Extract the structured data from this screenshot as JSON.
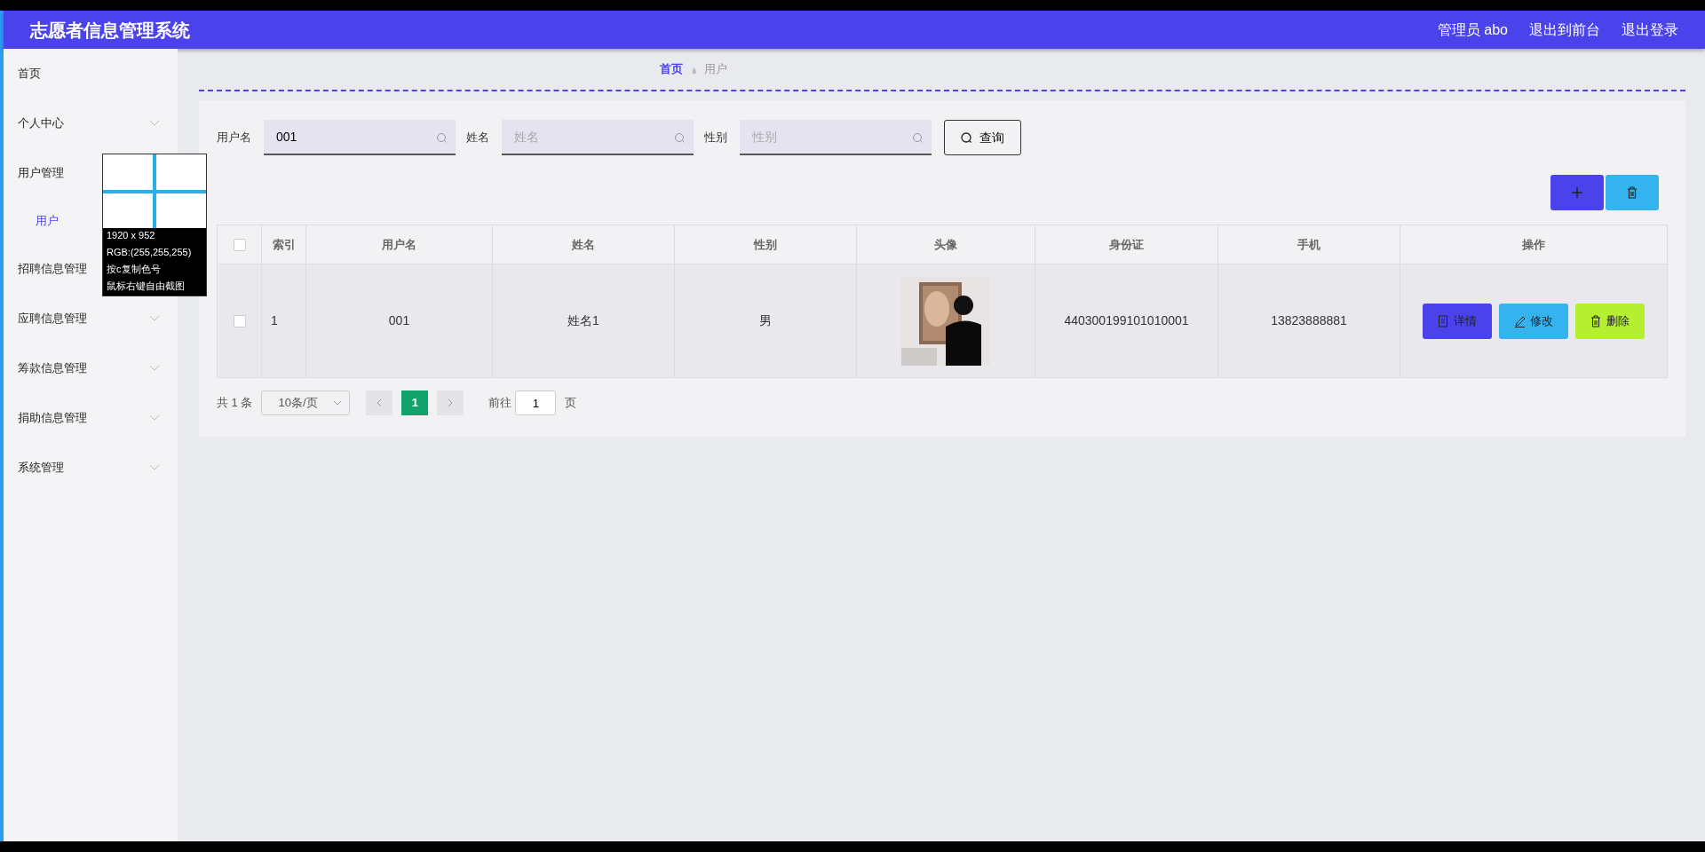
{
  "header": {
    "title": "志愿者信息管理系统",
    "links": [
      "管理员 abo",
      "退出到前台",
      "退出登录"
    ]
  },
  "sidebar": {
    "items": [
      {
        "label": "首页",
        "kind": "link"
      },
      {
        "label": "个人中心",
        "kind": "menu",
        "expanded": false
      },
      {
        "label": "用户管理",
        "kind": "menu",
        "expanded": true,
        "children": [
          {
            "label": "用户",
            "selected": true
          }
        ]
      },
      {
        "label": "招聘信息管理",
        "kind": "menu",
        "expanded": false
      },
      {
        "label": "应聘信息管理",
        "kind": "menu",
        "expanded": false
      },
      {
        "label": "筹款信息管理",
        "kind": "menu",
        "expanded": false
      },
      {
        "label": "捐助信息管理",
        "kind": "menu",
        "expanded": false
      },
      {
        "label": "系统管理",
        "kind": "menu",
        "expanded": false
      }
    ]
  },
  "breadcrumb": [
    {
      "label": "首页",
      "selected": true
    },
    {
      "label": "用户",
      "selected": false
    }
  ],
  "search": {
    "fields": [
      {
        "label": "用户名",
        "value": "001"
      },
      {
        "label": "姓名",
        "placeholder": "姓名"
      },
      {
        "label": "性别",
        "placeholder": "性别"
      }
    ],
    "button": "查询"
  },
  "table": {
    "header_checked": false,
    "columns": [
      "索引",
      "用户名",
      "姓名",
      "性别",
      "头像",
      "身份证",
      "手机",
      "操作"
    ],
    "rows": [
      {
        "checked": false,
        "index": "1",
        "username": "001",
        "name": "姓名1",
        "gender": "男",
        "avatar": {
          "kind": "picture"
        },
        "id_card": "440300199101010001",
        "phone": "13823888881",
        "actions": [
          {
            "kind": "detail",
            "label": "详情"
          },
          {
            "kind": "edit",
            "label": "修改"
          },
          {
            "kind": "delete",
            "label": "删除"
          }
        ]
      }
    ]
  },
  "pagination": {
    "total": "共 1 条",
    "page_size": "10条/页",
    "pages": [
      {
        "label": "1",
        "selected": true
      }
    ],
    "goto_label": "前往",
    "goto_value": "1",
    "goto_suffix": "页"
  },
  "overlay": {
    "lines": [
      "1920 x 952",
      "RGB:(255,255,255)",
      "按c复制色号",
      "鼠标右键自由截图"
    ]
  }
}
